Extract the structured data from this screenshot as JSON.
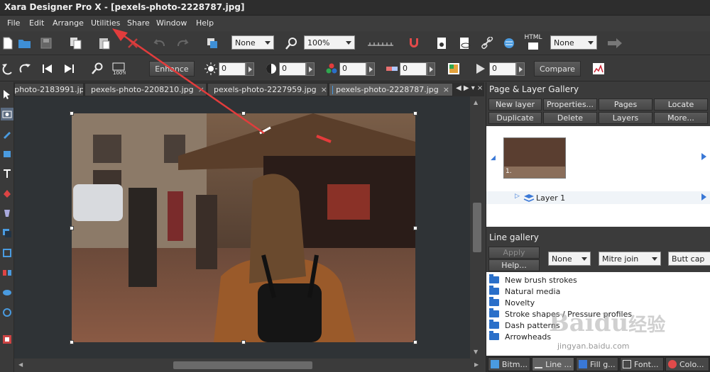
{
  "window": {
    "title": "Xara Designer Pro X - [pexels-photo-2228787.jpg]"
  },
  "menu": [
    "File",
    "Edit",
    "Arrange",
    "Utilities",
    "Share",
    "Window",
    "Help"
  ],
  "toolbar1": {
    "line_combo": "None",
    "zoom_combo": "100%",
    "quality_combo": "None",
    "html_label": "HTML"
  },
  "toolbar2": {
    "enhance_label": "Enhance",
    "brightness": "0",
    "contrast": "0",
    "saturation": "0",
    "temperature": "0",
    "transparency": "0",
    "compare_label": "Compare"
  },
  "doc_tabs": [
    {
      "label": "pexels-photo-2183991.jpg",
      "active": false
    },
    {
      "label": "pexels-photo-2208210.jpg",
      "active": false
    },
    {
      "label": "pexels-photo-2227959.jpg",
      "active": false
    },
    {
      "label": "pexels-photo-2228787.jpg",
      "active": true
    }
  ],
  "page_layer_gallery": {
    "title": "Page & Layer Gallery",
    "buttons": [
      "New layer",
      "Properties...",
      "Pages",
      "Locate",
      "Duplicate",
      "Delete",
      "Layers",
      "More..."
    ],
    "page_label": "1.",
    "layer_name": "Layer 1"
  },
  "line_gallery": {
    "title": "Line gallery",
    "apply_label": "Apply",
    "help_label": "Help...",
    "dash_combo": "None",
    "join_combo": "Mitre join",
    "cap_combo": "Butt cap",
    "items": [
      "New brush strokes",
      "Natural media",
      "Novelty",
      "Stroke shapes / Pressure profiles",
      "Dash patterns",
      "Arrowheads"
    ]
  },
  "bottom_tabs": [
    {
      "label": "Bitm...",
      "active": false
    },
    {
      "label": "Line ...",
      "active": true
    },
    {
      "label": "Fill g...",
      "active": false
    },
    {
      "label": "Font...",
      "active": false
    },
    {
      "label": "Colo...",
      "active": false
    }
  ],
  "watermark": {
    "brand": "Bai",
    "brand2": "du",
    "cn": "经验",
    "url": "jingyan.baidu.com"
  },
  "colors": {
    "accent_arrow": "#e23c3c",
    "folder_blue": "#2a6fc9",
    "selection": "#3a78d6"
  }
}
